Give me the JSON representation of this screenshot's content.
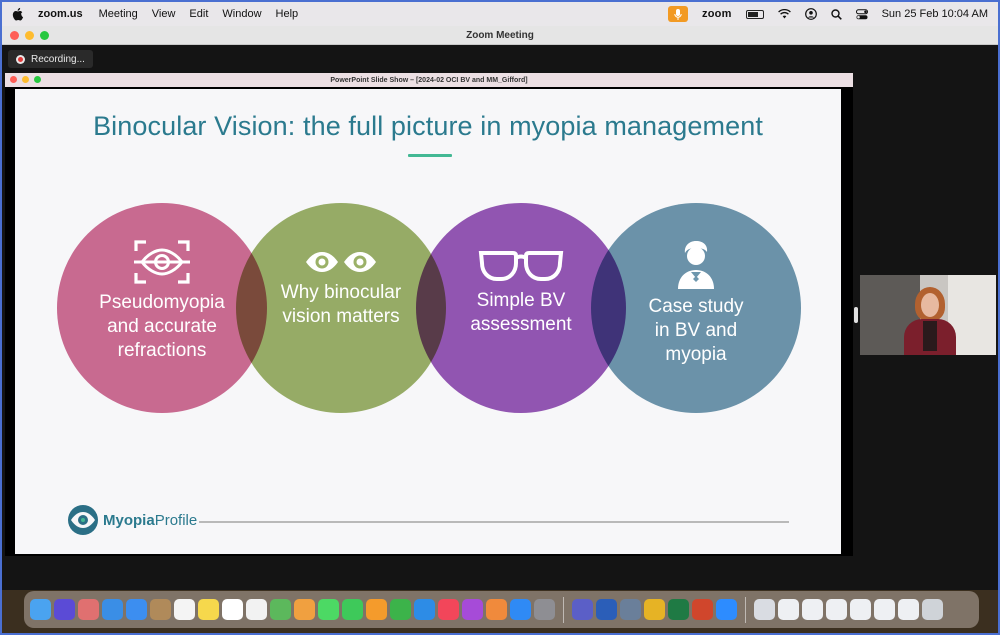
{
  "menubar": {
    "app_name": "zoom.us",
    "menus": [
      "Meeting",
      "View",
      "Edit",
      "Window",
      "Help"
    ],
    "zoom_status": "zoom",
    "clock": "Sun 25 Feb  10:04 AM"
  },
  "zoom_window": {
    "title": "Zoom Meeting",
    "recording_label": "Recording..."
  },
  "ppt_window": {
    "title": "PowerPoint Slide Show – [2024-02 OCI BV and MM_Gifford]"
  },
  "slide": {
    "title": "Binocular Vision: the full picture in myopia management",
    "circles": [
      {
        "icon": "eye-scan-icon",
        "lines": [
          "Pseudomyopia",
          "and accurate",
          "refractions"
        ],
        "color": "#cf6d94"
      },
      {
        "icon": "eyes-icon",
        "lines": [
          "Why binocular",
          "vision matters"
        ],
        "color": "#9bb168"
      },
      {
        "icon": "glasses-icon",
        "lines": [
          "Simple BV",
          "assessment"
        ],
        "color": "#9658b5"
      },
      {
        "icon": "person-icon",
        "lines": [
          "Case study",
          "in BV and",
          "myopia"
        ],
        "color": "#6e97ad"
      }
    ],
    "logo": {
      "part1": "Myopia",
      "part2": "Profile"
    },
    "accent_color": "#43b894"
  },
  "dock": {
    "icons": [
      {
        "name": "finder-icon",
        "color": "#4aa3f0"
      },
      {
        "name": "siri-icon",
        "color": "#5b4bd6"
      },
      {
        "name": "launchpad-icon",
        "color": "#e07070"
      },
      {
        "name": "safari-icon",
        "color": "#3a8ee6"
      },
      {
        "name": "mail-icon",
        "color": "#3c8ef0"
      },
      {
        "name": "contacts-icon",
        "color": "#b08a5a"
      },
      {
        "name": "calendar-icon",
        "color": "#f4f4f4"
      },
      {
        "name": "notes-icon",
        "color": "#f6d84c"
      },
      {
        "name": "freeform-icon",
        "color": "#ffffff"
      },
      {
        "name": "reminders-icon",
        "color": "#f2f2f2"
      },
      {
        "name": "maps-icon",
        "color": "#5cb85c"
      },
      {
        "name": "photos-icon",
        "color": "#f0a040"
      },
      {
        "name": "messages-icon",
        "color": "#4cd964"
      },
      {
        "name": "facetime-icon",
        "color": "#3ec95a"
      },
      {
        "name": "pages-icon",
        "color": "#f49b2c"
      },
      {
        "name": "numbers-icon",
        "color": "#3cb34a"
      },
      {
        "name": "keynote-icon",
        "color": "#2d8ce6"
      },
      {
        "name": "music-icon",
        "color": "#f2465a"
      },
      {
        "name": "podcasts-icon",
        "color": "#a64bd8"
      },
      {
        "name": "snowflake-app-icon",
        "color": "#f08a3c"
      },
      {
        "name": "app-store-icon",
        "color": "#2f8af5"
      },
      {
        "name": "system-settings-icon",
        "color": "#8e8e93"
      }
    ],
    "icons2": [
      {
        "name": "teams-icon",
        "color": "#5b5fc7"
      },
      {
        "name": "word-icon",
        "color": "#2b5eb8"
      },
      {
        "name": "screen-share-icon",
        "color": "#6a7f9a"
      },
      {
        "name": "chrome-icon",
        "color": "#e6b325"
      },
      {
        "name": "excel-icon",
        "color": "#1f7a44"
      },
      {
        "name": "powerpoint-icon",
        "color": "#d0462c"
      },
      {
        "name": "zoom-app-icon",
        "color": "#2d8cff"
      }
    ],
    "icons3": [
      {
        "name": "preview-icon",
        "color": "#d9dce2"
      },
      {
        "name": "window-thumb-1-icon",
        "color": "#eef0f3"
      },
      {
        "name": "window-thumb-2-icon",
        "color": "#eef0f3"
      },
      {
        "name": "window-thumb-3-icon",
        "color": "#eef0f3"
      },
      {
        "name": "window-thumb-4-icon",
        "color": "#eef0f3"
      },
      {
        "name": "window-thumb-5-icon",
        "color": "#eef0f3"
      },
      {
        "name": "window-thumb-6-icon",
        "color": "#eef0f3"
      },
      {
        "name": "trash-icon",
        "color": "#cfd3d8"
      }
    ]
  }
}
